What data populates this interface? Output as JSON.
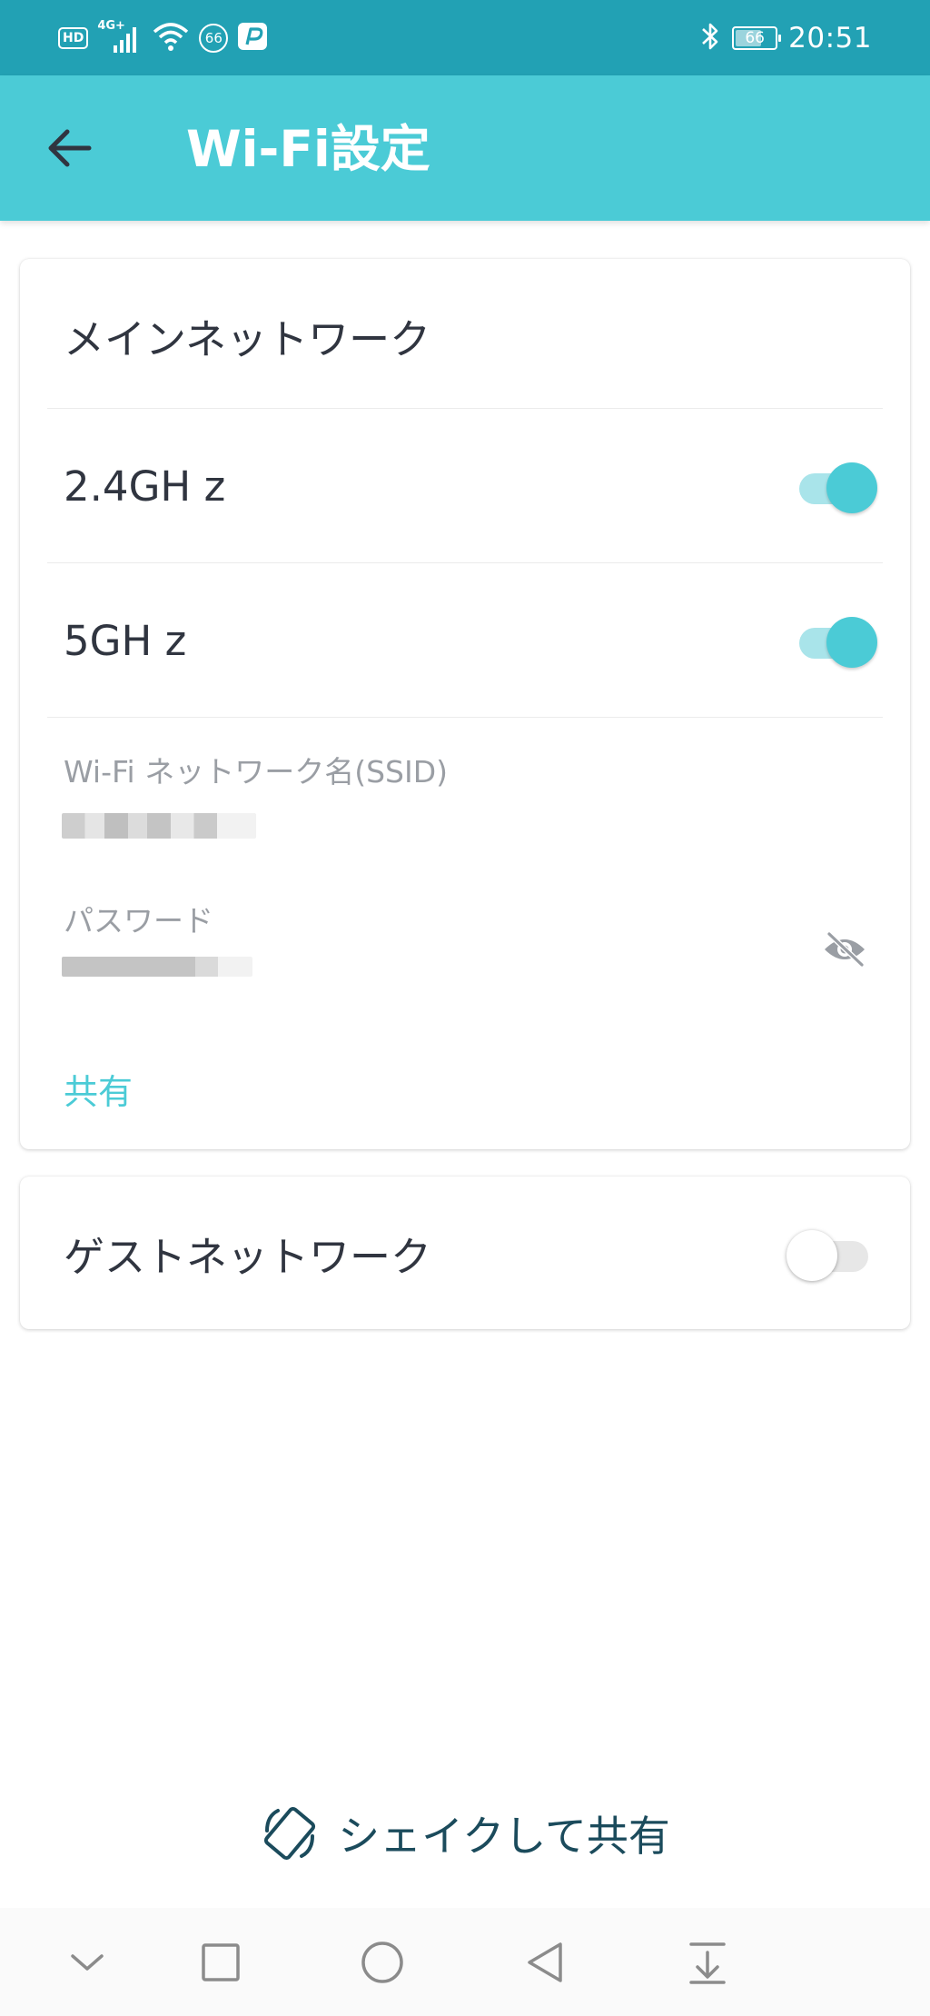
{
  "status_bar": {
    "hd_label": "HD",
    "network_label": "4G+",
    "notification_count": "66",
    "battery_level": "66",
    "time": "20:51"
  },
  "app_bar": {
    "title": "Wi-Fi設定",
    "back_icon": "arrow-left-icon"
  },
  "main_network": {
    "title": "メインネットワーク",
    "band_24": {
      "label": "2.4GH z",
      "enabled": true
    },
    "band_5": {
      "label": "5GH z",
      "enabled": true
    },
    "ssid_label": "Wi-Fi ネットワーク名(SSID)",
    "password_label": "パスワード",
    "visibility_icon": "eye-off-icon",
    "share_label": "共有"
  },
  "guest_network": {
    "title": "ゲストネットワーク",
    "enabled": false
  },
  "shake_share": {
    "label": "シェイクして共有",
    "icon": "phone-rotate-icon"
  },
  "nav_bar": {
    "icons": [
      "chevron-down-icon",
      "square-icon",
      "circle-icon",
      "triangle-back-icon",
      "notification-pull-icon"
    ]
  },
  "colors": {
    "status_bar": "#22a1b4",
    "accent": "#4bcbd6",
    "text_primary": "#303540",
    "text_secondary": "#9a9ea4",
    "shake_text": "#1b4b5c"
  }
}
